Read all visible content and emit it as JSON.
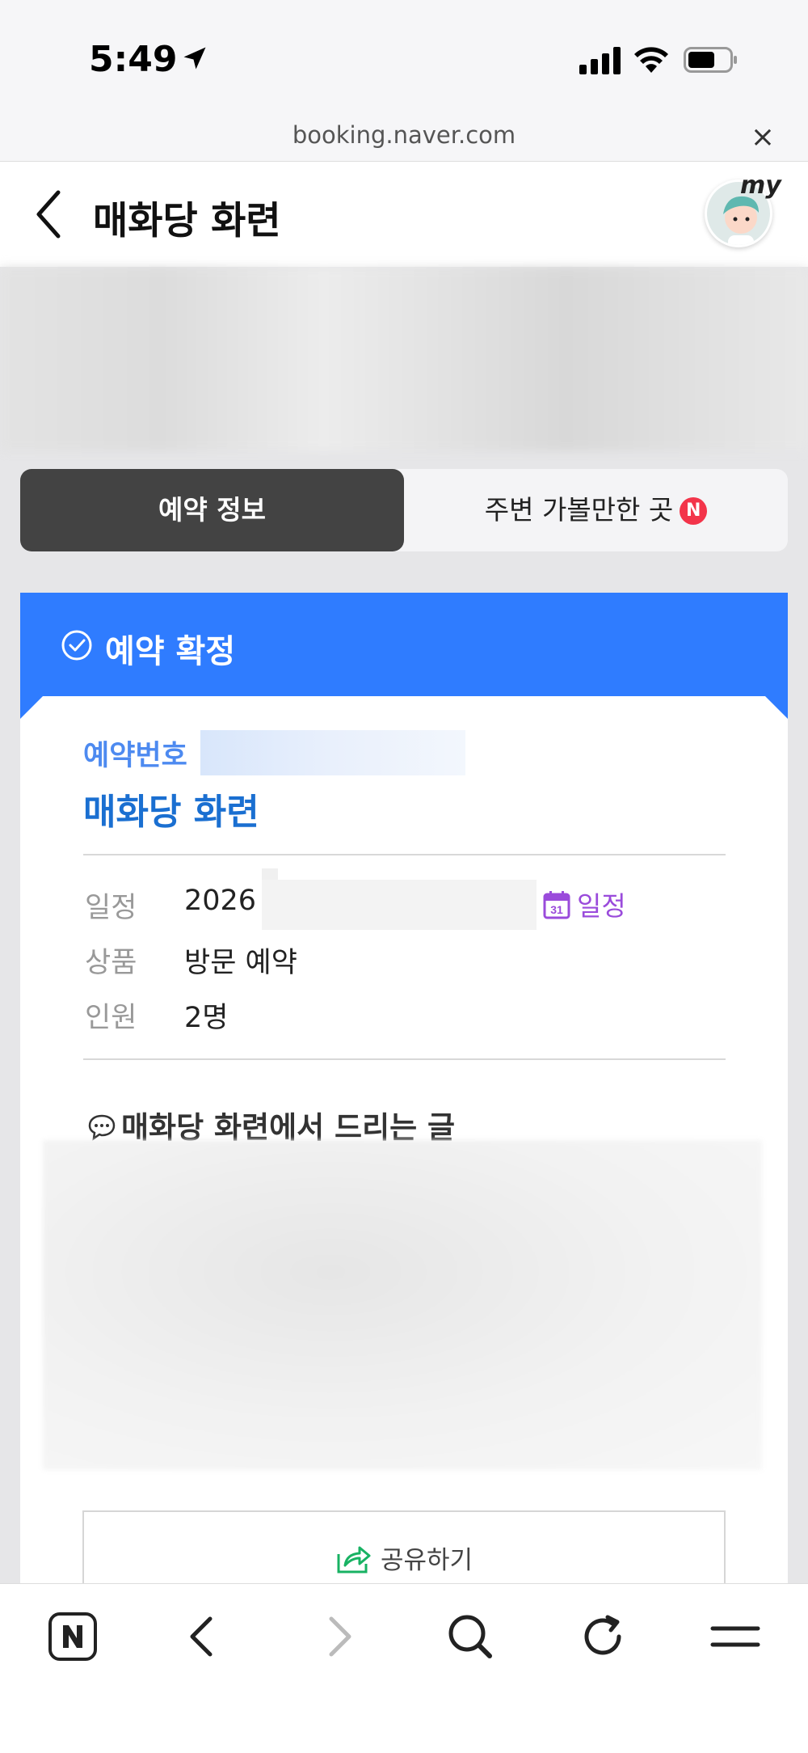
{
  "status": {
    "time": "5:49"
  },
  "browser": {
    "url": "booking.naver.com",
    "close": "×"
  },
  "header": {
    "title": "매화당 화련",
    "avatar_text": "my"
  },
  "tabs": [
    {
      "label": "예약 정보",
      "active": true
    },
    {
      "label": "주변 가볼만한 곳",
      "badge": "N",
      "active": false
    }
  ],
  "confirm": {
    "label": "예약 확정"
  },
  "reservation": {
    "number_label": "예약번호",
    "shop_name": "매화당 화련",
    "rows": [
      {
        "label": "일정",
        "value": "2026"
      },
      {
        "label": "상품",
        "value": "방문 예약"
      },
      {
        "label": "인원",
        "value": "2명"
      }
    ],
    "calendar_link": "일정",
    "calendar_day": "31"
  },
  "message": {
    "title": "매화당 화련에서 드리는 글"
  },
  "share": {
    "label": "공유하기"
  },
  "colors": {
    "accent": "#2f7cff",
    "shop_name": "#1a6fd1",
    "calendar": "#9a4bdb",
    "badge": "#f3344a",
    "tab_active": "#434343"
  },
  "toolbar": [
    "naver-icon",
    "back-icon",
    "forward-icon",
    "search-icon",
    "reload-icon",
    "menu-icon"
  ]
}
